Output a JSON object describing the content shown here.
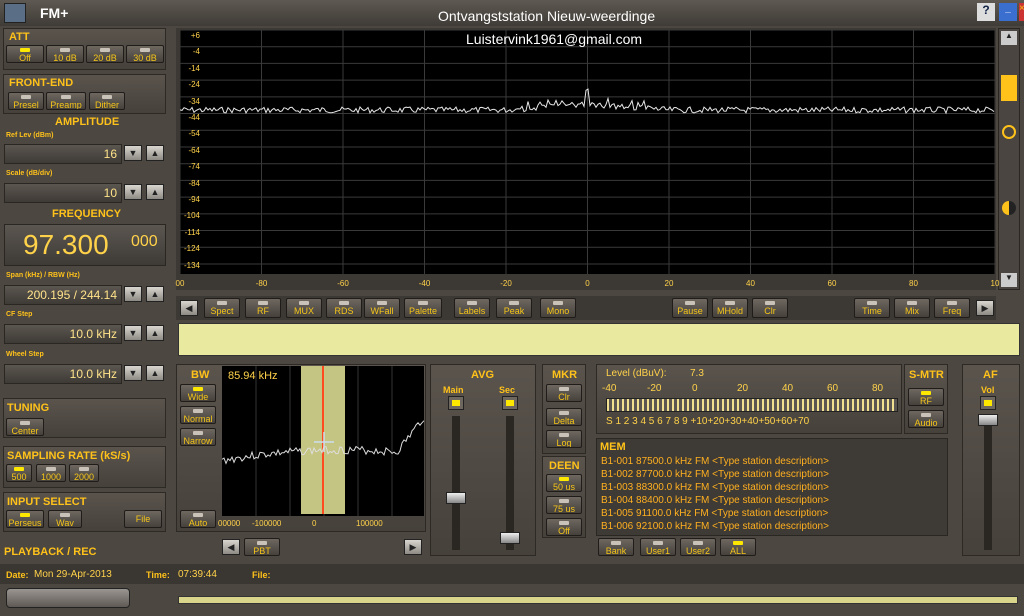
{
  "window": {
    "title": "FM+",
    "title_center": "Ontvangststation Nieuw-weerdinge",
    "email": "Luistervink1961@gmail.com",
    "help": "?",
    "minimize": "_",
    "close": "×"
  },
  "att": {
    "label": "ATT",
    "buttons": [
      "Off",
      "10 dB",
      "20 dB",
      "30 dB"
    ]
  },
  "frontend": {
    "label": "FRONT-END",
    "buttons": [
      "Presel",
      "Preamp",
      "Dither"
    ]
  },
  "amplitude": {
    "label": "AMPLITUDE",
    "ref_label": "Ref Lev (dBm)",
    "ref_value": "16",
    "scale_label": "Scale (dB/div)",
    "scale_value": "10"
  },
  "frequency": {
    "label": "FREQUENCY",
    "main": "97.300",
    "sub": "000",
    "span_label": "Span (kHz) / RBW (Hz)",
    "span_value": "200.195 / 244.14",
    "cfstep_label": "CF Step",
    "cfstep_value": "10.0 kHz",
    "wheel_label": "Wheel Step",
    "wheel_value": "10.0 kHz"
  },
  "tuning": {
    "label": "TUNING",
    "center": "Center"
  },
  "sampling": {
    "label": "SAMPLING RATE (kS/s)",
    "buttons": [
      "500",
      "1000",
      "2000"
    ]
  },
  "input": {
    "label": "INPUT SELECT",
    "buttons": [
      "Perseus",
      "Wav",
      "File"
    ]
  },
  "playback": {
    "label": "PLAYBACK / REC",
    "date_label": "Date:",
    "date": "Mon 29-Apr-2013",
    "time_label": "Time:",
    "time": "07:39:44",
    "file_label": "File:"
  },
  "spectrum": {
    "y_ticks": [
      "+6",
      "-4",
      "-14",
      "-24",
      "-34",
      "-44",
      "-54",
      "-64",
      "-74",
      "-84",
      "-94",
      "-104",
      "-114",
      "-124",
      "-134"
    ],
    "x_ticks": [
      "00",
      "-80",
      "-60",
      "-40",
      "-20",
      "0",
      "20",
      "40",
      "60",
      "80",
      "10"
    ]
  },
  "toolbar": {
    "left": "◀",
    "right": "▶",
    "buttons": [
      "Spect",
      "RF",
      "MUX",
      "RDS",
      "WFall",
      "Palette",
      "Labels",
      "Peak",
      "Mono",
      "Pause",
      "MHold",
      "Clr",
      "Time",
      "Mix",
      "Freq"
    ]
  },
  "bw": {
    "label": "BW",
    "buttons": [
      "Wide",
      "Normal",
      "Narrow",
      "Auto"
    ],
    "freq": "85.94 kHz",
    "x_ticks": [
      "00000",
      "-100000",
      "0",
      "100000"
    ],
    "pbt": "PBT",
    "left": "◀",
    "right": "▶"
  },
  "avg": {
    "label": "AVG",
    "main": "Main",
    "sec": "Sec"
  },
  "mkr": {
    "label": "MKR",
    "buttons": [
      "Clr",
      "Delta",
      "Log"
    ]
  },
  "deen": {
    "label": "DEEN",
    "buttons": [
      "50 us",
      "75 us",
      "Off"
    ]
  },
  "level": {
    "label": "Level (dBuV):",
    "value": "7.3",
    "top_scale": [
      "-40",
      "-20",
      "0",
      "20",
      "40",
      "60",
      "80"
    ],
    "bottom_scale": "S  1  2  3  4  5  6  7  8  9  +10+20+30+40+50+60+70"
  },
  "smtr": {
    "label": "S-MTR",
    "buttons": [
      "RF",
      "Audio"
    ]
  },
  "af": {
    "label": "AF",
    "vol": "Vol"
  },
  "mem": {
    "label": "MEM",
    "rows": [
      "B1-001 87500.0 kHz  FM   <Type station description>",
      "B1-002 87700.0 kHz  FM   <Type station description>",
      "B1-003 88300.0 kHz  FM   <Type station description>",
      "B1-004 88400.0 kHz  FM   <Type station description>",
      "B1-005 91100.0 kHz  FM   <Type station description>",
      "B1-006 92100.0 kHz  FM   <Type station description>"
    ],
    "buttons": [
      "Bank",
      "User1",
      "User2",
      "ALL"
    ]
  },
  "colors": {
    "accent": "#ffc21a",
    "trace": "#e8e8e8",
    "band": "#e8e89a",
    "marker": "#ff4a20"
  }
}
